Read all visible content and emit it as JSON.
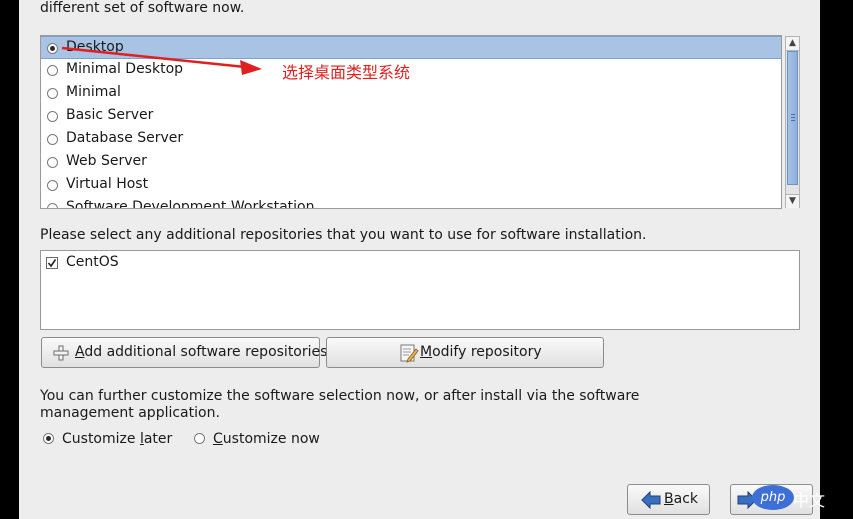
{
  "intro_text": "different set of software now.",
  "software_list": {
    "items": [
      {
        "label": "Desktop",
        "selected": true
      },
      {
        "label": "Minimal Desktop",
        "selected": false
      },
      {
        "label": "Minimal",
        "selected": false
      },
      {
        "label": "Basic Server",
        "selected": false
      },
      {
        "label": "Database Server",
        "selected": false
      },
      {
        "label": "Web Server",
        "selected": false
      },
      {
        "label": "Virtual Host",
        "selected": false
      },
      {
        "label": "Software Development Workstation",
        "selected": false
      }
    ]
  },
  "annotation": {
    "text": "选择桌面类型系统",
    "color": "#e02020"
  },
  "repos": {
    "prompt": "Please select any additional repositories that you want to use for software installation.",
    "items": [
      {
        "label": "CentOS",
        "checked": true
      }
    ]
  },
  "buttons": {
    "add_repo_rest": "dd additional software repositories",
    "add_repo_key": "A",
    "modify_repo_key": "M",
    "modify_repo_rest": "odify repository",
    "back_key": "B",
    "back_rest": "ack"
  },
  "customize": {
    "text_line1": "You can further customize the software selection now, or after install via the software",
    "text_line2": "management application.",
    "later_key": "l",
    "later_pre": "Customize ",
    "later_post": "ater",
    "now_key": "C",
    "now_rest": "ustomize now",
    "selected": "later"
  },
  "watermark": {
    "ball": "php",
    "text": "中文"
  },
  "colors": {
    "selection": "#a8c3e4",
    "panel": "#ededed",
    "accent_arrow": "#e02020"
  }
}
